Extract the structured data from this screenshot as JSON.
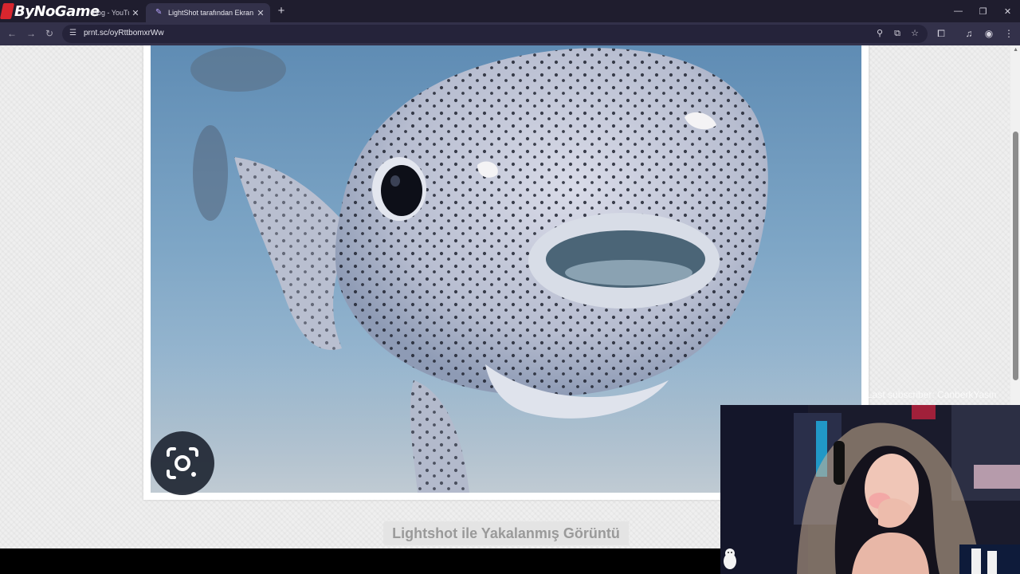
{
  "browser": {
    "logo_text": "ByNoGame",
    "tabs": [
      {
        "label": "Vlog - YouTube",
        "active": false
      },
      {
        "label": "LightShot tarafından Ekran Görüntüsü",
        "active": true
      }
    ],
    "url": "prnt.sc/oyRttbomxrWw",
    "new_tab_icon": "plus-icon"
  },
  "page": {
    "caption": "Lightshot ile Yakalanmış Görüntü",
    "image_subject": "spotted pufferfish underwater"
  },
  "overlay": {
    "subscriber_text": "Last subscriber: CanberkYasin"
  },
  "colors": {
    "tabbar": "#1f1d2e",
    "toolbar": "#33314a",
    "page_bg": "#efefef",
    "caption_bg": "#e4e4e4",
    "caption_text": "#9a9a9a"
  }
}
